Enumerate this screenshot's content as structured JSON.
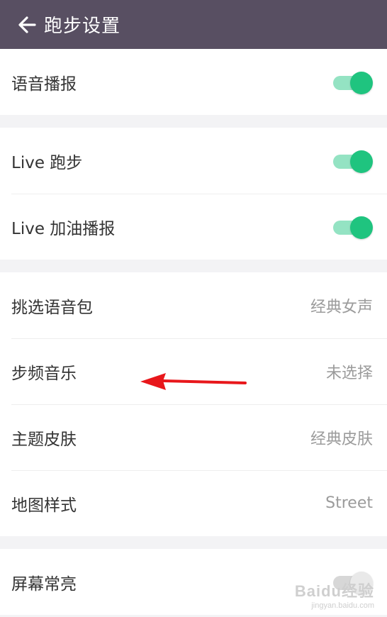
{
  "header": {
    "title": "跑步设置",
    "back_icon": "arrow-left-icon"
  },
  "groups": [
    {
      "rows": [
        {
          "label": "语音播报",
          "type": "toggle",
          "on": true
        }
      ]
    },
    {
      "rows": [
        {
          "label": "Live 跑步",
          "type": "toggle",
          "on": true
        },
        {
          "label": "Live 加油播报",
          "type": "toggle",
          "on": true
        }
      ]
    },
    {
      "rows": [
        {
          "label": "挑选语音包",
          "type": "value",
          "value": "经典女声"
        },
        {
          "label": "步频音乐",
          "type": "value",
          "value": "未选择"
        },
        {
          "label": "主题皮肤",
          "type": "value",
          "value": "经典皮肤"
        },
        {
          "label": "地图样式",
          "type": "value",
          "value": "Street"
        }
      ]
    },
    {
      "rows": [
        {
          "label": "屏幕常亮",
          "type": "toggle",
          "on": false
        }
      ]
    }
  ],
  "annotation": {
    "arrow_color": "#e8171b"
  },
  "watermark": {
    "logo": "Baidu经验",
    "url": "jingyan.baidu.com"
  },
  "colors": {
    "header_bg": "#584f62",
    "toggle_on": "#1fc47f",
    "toggle_track_on": "#94e3c3"
  }
}
